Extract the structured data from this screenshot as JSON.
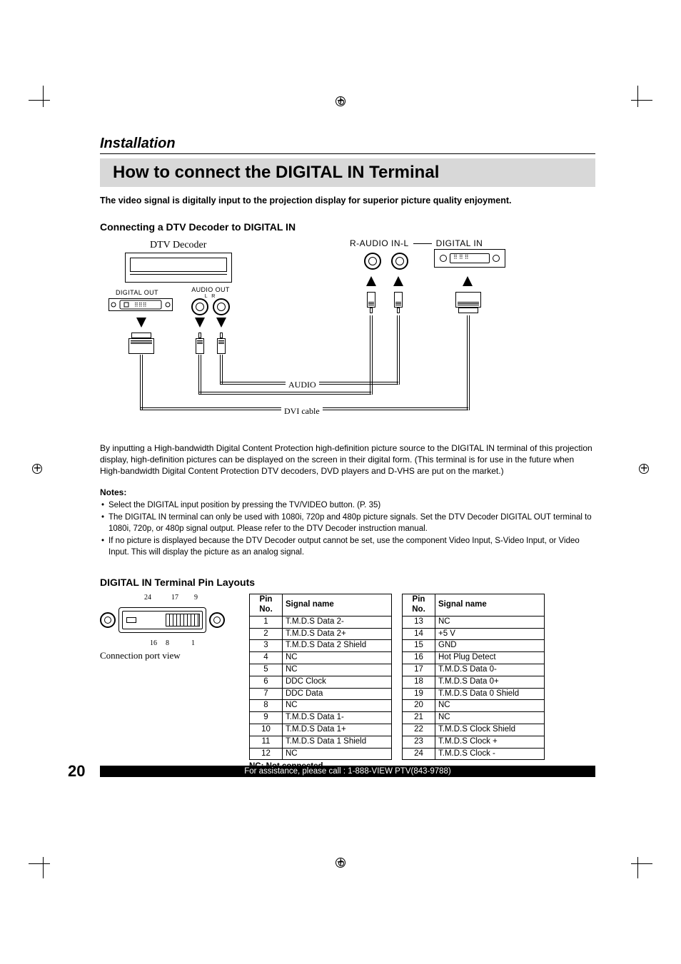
{
  "section_label": "Installation",
  "title": "How to connect the DIGITAL IN Terminal",
  "intro": "The video signal is digitally input to the projection display for superior picture quality enjoyment.",
  "subhead_connecting": "Connecting a DTV Decoder to DIGITAL IN",
  "diagram": {
    "dtv_decoder": "DTV Decoder",
    "digital_out": "DIGITAL OUT",
    "audio_out": "AUDIO OUT",
    "audio_out_sub": "L  R",
    "r_audio_in_l": "R-AUDIO IN-L",
    "digital_in": "DIGITAL IN",
    "audio_label": "AUDIO",
    "dvi_cable": "DVI cable"
  },
  "description": "By inputting a High-bandwidth Digital Content Protection high-definition picture source to the DIGITAL IN terminal of this projection display, high-definition pictures can be displayed on the screen in their digital form. (This terminal is for use in the future when High-bandwidth Digital Content Protection DTV decoders, DVD players and D-VHS are put on the market.)",
  "notes_head": "Notes:",
  "notes": [
    "Select the DIGITAL input position by pressing the TV/VIDEO button. (P. 35)",
    "The DIGITAL IN terminal can only be used with 1080i, 720p and 480p picture signals. Set the DTV Decoder DIGITAL OUT terminal to 1080i, 720p, or 480p signal output. Please refer to the DTV Decoder instruction manual.",
    "If no picture is displayed because the DTV Decoder output cannot be set, use the component Video Input, S-Video Input, or Video Input. This will display the picture as an analog signal."
  ],
  "subhead_pinlayouts": "DIGITAL IN Terminal Pin Layouts",
  "connector": {
    "n24": "24",
    "n17": "17",
    "n9": "9",
    "n16": "16",
    "n8": "8",
    "n1": "1",
    "caption": "Connection port view"
  },
  "table_headers": {
    "pin": "Pin No.",
    "signal": "Signal name"
  },
  "pins_left": [
    {
      "pin": "1",
      "signal": "T.M.D.S Data 2-"
    },
    {
      "pin": "2",
      "signal": "T.M.D.S Data 2+"
    },
    {
      "pin": "3",
      "signal": "T.M.D.S Data 2 Shield"
    },
    {
      "pin": "4",
      "signal": "NC"
    },
    {
      "pin": "5",
      "signal": "NC"
    },
    {
      "pin": "6",
      "signal": "DDC Clock"
    },
    {
      "pin": "7",
      "signal": "DDC Data"
    },
    {
      "pin": "8",
      "signal": "NC"
    },
    {
      "pin": "9",
      "signal": "T.M.D.S Data 1-"
    },
    {
      "pin": "10",
      "signal": "T.M.D.S Data 1+"
    },
    {
      "pin": "11",
      "signal": "T.M.D.S Data 1 Shield"
    },
    {
      "pin": "12",
      "signal": "NC"
    }
  ],
  "pins_right": [
    {
      "pin": "13",
      "signal": "NC"
    },
    {
      "pin": "14",
      "signal": "+5 V"
    },
    {
      "pin": "15",
      "signal": "GND"
    },
    {
      "pin": "16",
      "signal": "Hot Plug Detect"
    },
    {
      "pin": "17",
      "signal": "T.M.D.S Data 0-"
    },
    {
      "pin": "18",
      "signal": "T.M.D.S Data 0+"
    },
    {
      "pin": "19",
      "signal": "T.M.D.S Data 0 Shield"
    },
    {
      "pin": "20",
      "signal": "NC"
    },
    {
      "pin": "21",
      "signal": "NC"
    },
    {
      "pin": "22",
      "signal": "T.M.D.S Clock Shield"
    },
    {
      "pin": "23",
      "signal": "T.M.D.S Clock +"
    },
    {
      "pin": "24",
      "signal": "T.M.D.S Clock -"
    }
  ],
  "nc_note": "NC: Not connected",
  "page_number": "20",
  "footer_text": "For assistance, please call : 1-888-VIEW PTV(843-9788)"
}
